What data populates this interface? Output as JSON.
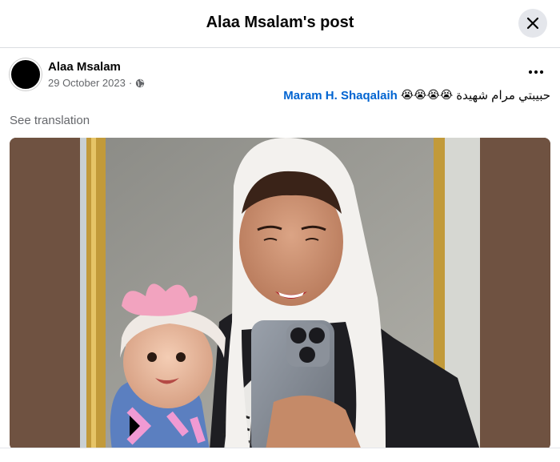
{
  "dialog": {
    "title": "Alaa Msalam's post",
    "close_icon": "close-icon"
  },
  "post": {
    "author": "Alaa Msalam",
    "date": "29 October 2023",
    "separator": "·",
    "privacy_icon": "globe-icon",
    "more_icon": "more-horizontal-icon",
    "text_body": "حبيبتي مرام شهيدة",
    "emojis": "😭😭😭😭",
    "mention": "Maram H. Shaqalaih",
    "see_translation": "See translation",
    "photo": {
      "description_icon": "photo-mother-and-baby-selfie",
      "background_color": "#6f5241"
    }
  },
  "colors": {
    "link": "#0064d1",
    "secondary_text": "#65676b",
    "close_bg": "#e4e6eb"
  }
}
